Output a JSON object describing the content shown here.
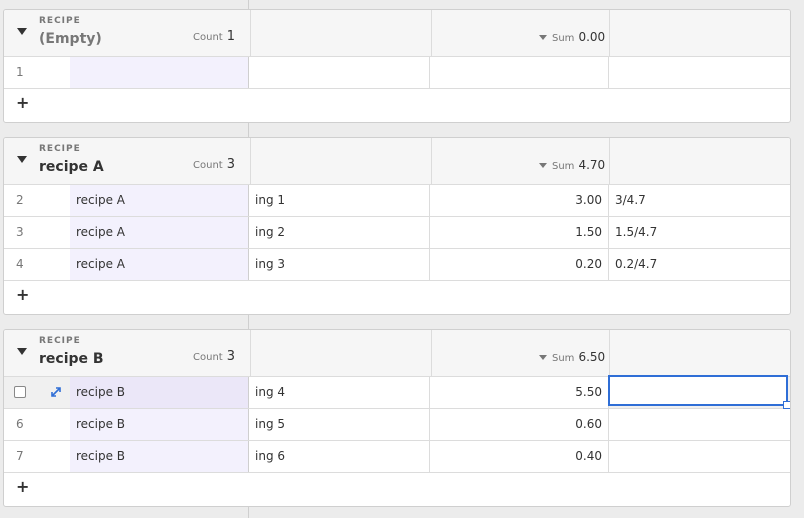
{
  "groups": [
    {
      "caption": "RECIPE",
      "value": "(Empty)",
      "count_label": "Count",
      "count": "1",
      "sum_label": "Sum",
      "sum": "0.00",
      "rows": [
        {
          "num": "1",
          "recipe": "",
          "ingredient": "",
          "qty": "",
          "fraction": ""
        }
      ],
      "add_label": "+"
    },
    {
      "caption": "RECIPE",
      "value": "recipe A",
      "count_label": "Count",
      "count": "3",
      "sum_label": "Sum",
      "sum": "4.70",
      "rows": [
        {
          "num": "2",
          "recipe": "recipe A",
          "ingredient": "ing 1",
          "qty": "3.00",
          "fraction": "3/4.7"
        },
        {
          "num": "3",
          "recipe": "recipe A",
          "ingredient": "ing 2",
          "qty": "1.50",
          "fraction": "1.5/4.7"
        },
        {
          "num": "4",
          "recipe": "recipe A",
          "ingredient": "ing 3",
          "qty": "0.20",
          "fraction": "0.2/4.7"
        }
      ],
      "add_label": "+"
    },
    {
      "caption": "RECIPE",
      "value": "recipe B",
      "count_label": "Count",
      "count": "3",
      "sum_label": "Sum",
      "sum": "6.50",
      "rows": [
        {
          "num": "",
          "recipe": "recipe B",
          "ingredient": "ing 4",
          "qty": "5.50",
          "fraction": ""
        },
        {
          "num": "6",
          "recipe": "recipe B",
          "ingredient": "ing 5",
          "qty": "0.60",
          "fraction": ""
        },
        {
          "num": "7",
          "recipe": "recipe B",
          "ingredient": "ing 6",
          "qty": "0.40",
          "fraction": ""
        }
      ],
      "add_label": "+"
    }
  ],
  "colors": {
    "accent": "#2f6ed6",
    "link_column_bg": "#f3f1fd"
  },
  "icons": {
    "expand_row": "expand-arrows-icon",
    "group_toggle": "caret-down-icon",
    "sort": "sort-desc-icon"
  }
}
